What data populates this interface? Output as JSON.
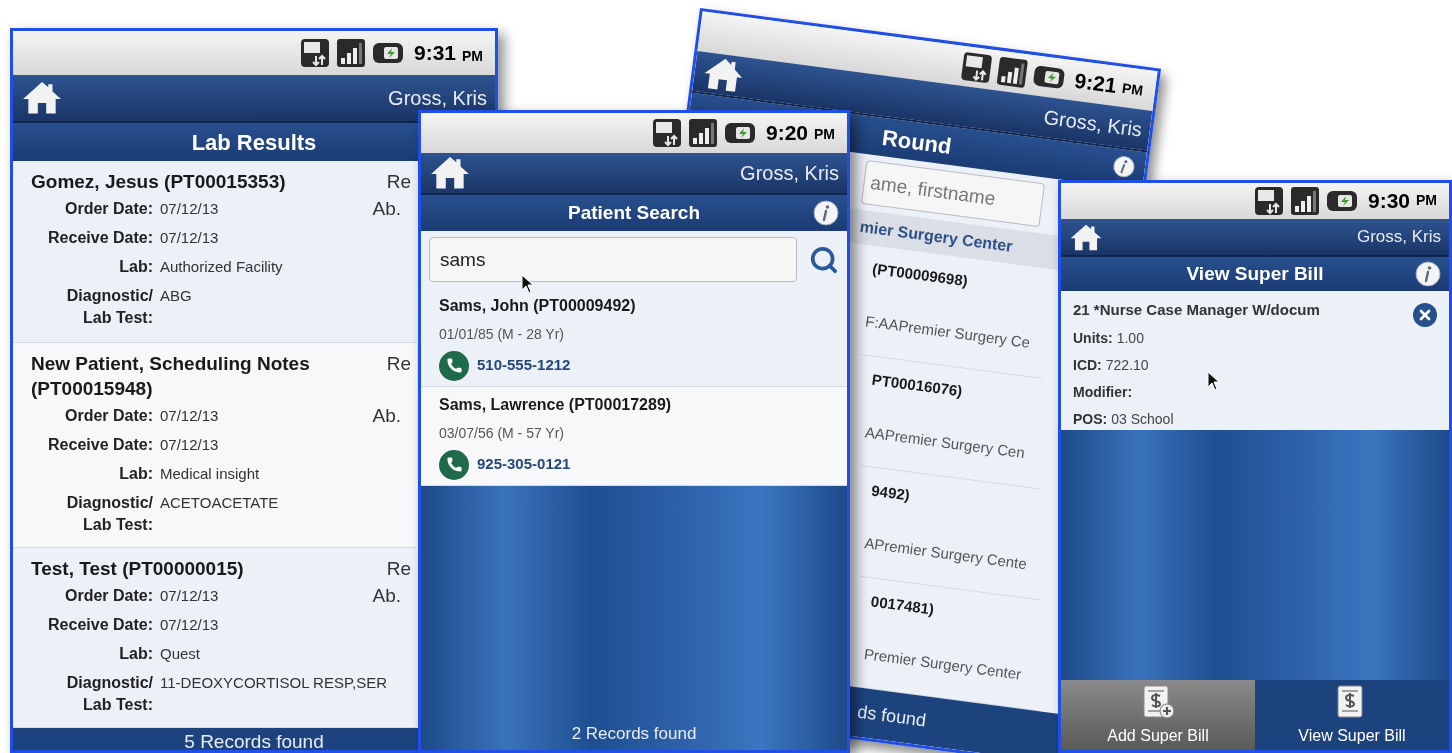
{
  "screens": [
    {
      "kind": "lab_results",
      "time": "9:31",
      "meridiem": "PM",
      "user": "Gross, Kris",
      "title": "Lab Results",
      "records": [
        {
          "name": "Gomez, Jesus (PT00015353)",
          "column_2": "Re",
          "column_3": "Ab.",
          "fields": [
            {
              "label": "Order Date:",
              "value": "07/12/13"
            },
            {
              "label": "Receive Date:",
              "value": "07/12/13"
            },
            {
              "label": "Lab:",
              "value": "Authorized Facility"
            },
            {
              "label": "Diagnostic/\nLab Test:",
              "value": "ABG"
            }
          ]
        },
        {
          "name": "New Patient, Scheduling Notes (PT00015948)",
          "column_2": "Re",
          "column_3": "Ab.",
          "fields": [
            {
              "label": "Order Date:",
              "value": "07/12/13"
            },
            {
              "label": "Receive Date:",
              "value": "07/12/13"
            },
            {
              "label": "Lab:",
              "value": "Medical insight"
            },
            {
              "label": "Diagnostic/\nLab Test:",
              "value": "ACETOACETATE"
            }
          ]
        },
        {
          "name": "Test, Test (PT00000015)",
          "column_2": "Re",
          "column_3": "Ab.",
          "fields": [
            {
              "label": "Order Date:",
              "value": "07/12/13"
            },
            {
              "label": "Receive Date:",
              "value": "07/12/13"
            },
            {
              "label": "Lab:",
              "value": "Quest"
            },
            {
              "label": "Diagnostic/\nLab Test:",
              "value": "11-DEOXYCORTISOL RESP,SER"
            }
          ]
        }
      ],
      "footer": "5 Records found"
    },
    {
      "kind": "round",
      "time": "9:21",
      "meridiem": "PM",
      "user": "Gross, Kris",
      "title": "Round",
      "search": {
        "placeholder": "ame, firstname"
      },
      "group": "mier Surgery Center",
      "rows": [
        {
          "id": "(PT00009698)",
          "facility": "F:AAPremier Surgery Ce"
        },
        {
          "id": "PT00016076)",
          "facility": "AAPremier Surgery Cen"
        },
        {
          "id": "9492)",
          "facility": "APremier Surgery Cente"
        },
        {
          "id": "0017481)",
          "facility": "Premier Surgery Center"
        }
      ],
      "footer": "ds found"
    },
    {
      "kind": "patient_search",
      "time": "9:20",
      "meridiem": "PM",
      "user": "Gross, Kris",
      "title": "Patient Search",
      "search": {
        "value": "sams"
      },
      "patients": [
        {
          "name": "Sams, John (PT00009492)",
          "details": "01/01/85 (M - 28 Yr)",
          "phone": "510-555-1212"
        },
        {
          "name": "Sams, Lawrence (PT00017289)",
          "details": "03/07/56 (M - 57 Yr)",
          "phone": "925-305-0121"
        }
      ],
      "footer": "2 Records found"
    },
    {
      "kind": "super_bill",
      "time": "9:30",
      "meridiem": "PM",
      "user": "Gross, Kris",
      "title": "View Super Bill",
      "item": {
        "title": "21 *Nurse Case Manager W/docum",
        "fields": [
          {
            "label": "Units:",
            "value": "1.00"
          },
          {
            "label": "ICD:",
            "value": "722.10"
          },
          {
            "label": "Modifier:"
          },
          {
            "label": "POS:",
            "value": "03 School"
          }
        ]
      },
      "tabs": [
        {
          "label": "Add Super Bill",
          "kind": "add",
          "selected": false
        },
        {
          "label": "View Super Bill",
          "kind": "view",
          "selected": true
        }
      ]
    }
  ]
}
